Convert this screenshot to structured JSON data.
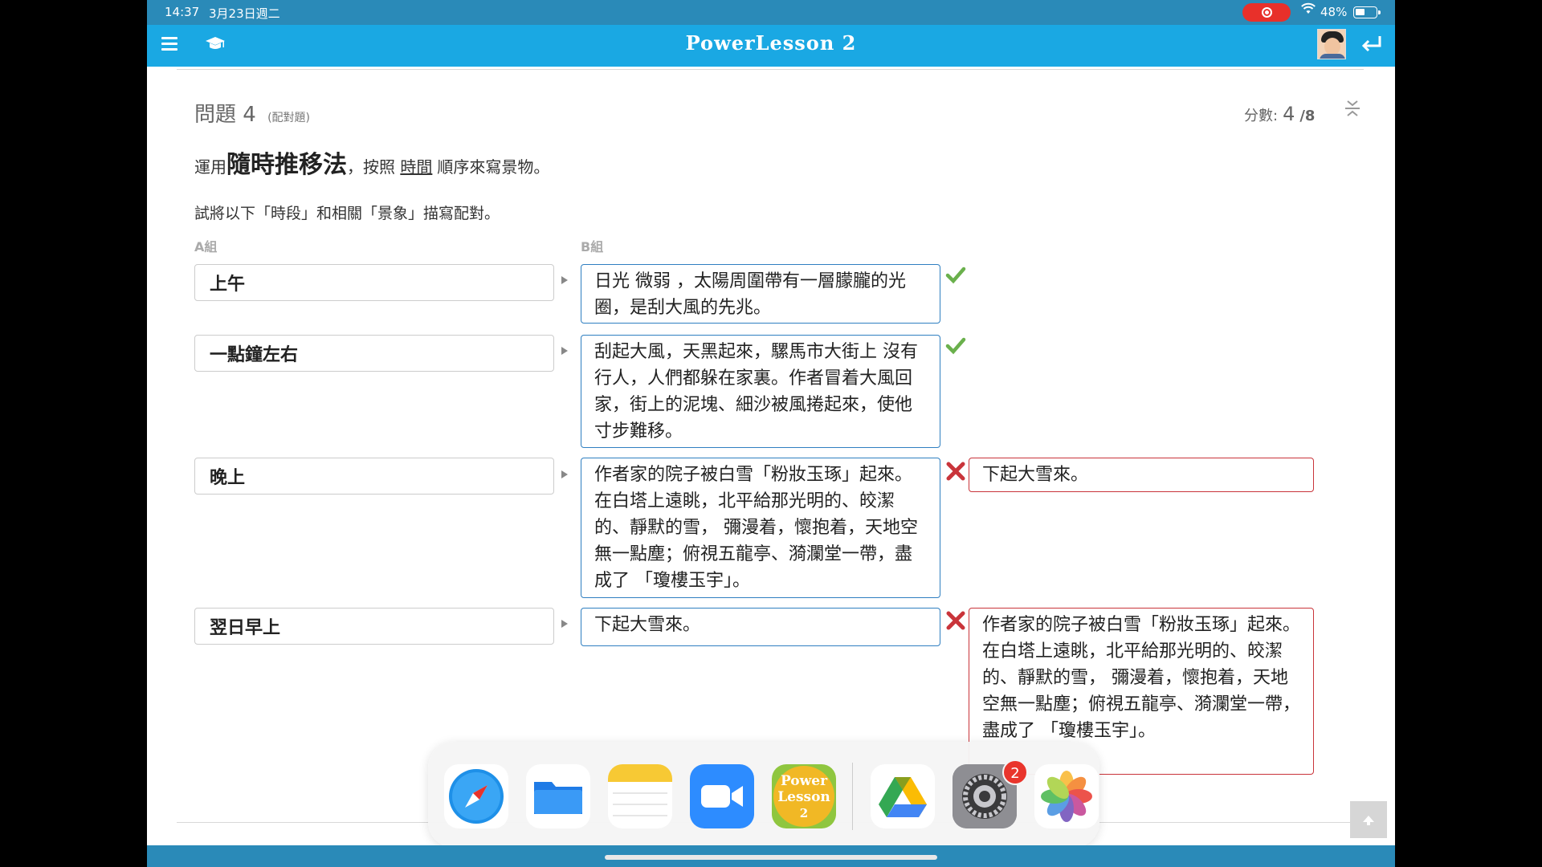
{
  "status_bar": {
    "time": "14:37",
    "date": "3月23日週二",
    "battery": "48%"
  },
  "app": {
    "title": "PowerLesson 2",
    "accent_color": "#1aa8e3"
  },
  "question": {
    "label": "問題",
    "number": "4",
    "type": "(配對題)",
    "score_label": "分數:",
    "score_value": "4",
    "score_max": "/8",
    "instruction_prefix": "運用",
    "instruction_bold": "隨時推移法",
    "instruction_mid": "，按照",
    "instruction_underline": "時間",
    "instruction_suffix": "順序來寫景物。",
    "subinstruction": "試將以下「時段」和相關「景象」描寫配對。",
    "group_a_label": "A組",
    "group_b_label": "B組"
  },
  "pairs": [
    {
      "a": "上午",
      "b": "日光 微弱 ，太陽周圍帶有一層朦朧的光圈，是刮大風的先兆。",
      "result": "correct",
      "correct_answer": ""
    },
    {
      "a": "一點鐘左右",
      "b": "刮起大風，天黑起來，騾馬市大街上 沒有行人，人們都躲在家裏。作者冒着大風回家，街上的泥塊、細沙被風捲起來，使他寸步難移。",
      "result": "correct",
      "correct_answer": ""
    },
    {
      "a": "晚上",
      "b": "作者家的院子被白雪「粉妝玉琢」起來。在白塔上遠眺，北平給那光明的、皎潔的、靜默的雪， 彌漫着，懷抱着，天地空無一點塵；俯視五龍亭、漪瀾堂一帶，盡成了 「瓊樓玉宇」。",
      "result": "wrong",
      "correct_answer": "下起大雪來。"
    },
    {
      "a": "翌日早上",
      "b": "下起大雪來。",
      "result": "wrong",
      "correct_answer": "作者家的院子被白雪「粉妝玉琢」起來。在白塔上遠眺，北平給那光明的、皎潔的、靜默的雪， 彌漫着，懷抱着，天地空無一點塵；俯視五龍亭、漪瀾堂一帶，盡成了 「瓊樓玉宇」。"
    }
  ],
  "dock": {
    "apps": [
      "safari-icon",
      "files-icon",
      "notes-icon",
      "zoom-icon",
      "powerlesson-icon",
      "google-drive-icon",
      "settings-icon",
      "photos-icon"
    ],
    "settings_badge": "2",
    "powerlesson_icon_text": [
      "Power",
      "Lesson",
      "2"
    ]
  },
  "colors": {
    "correct": "#6ab04c",
    "wrong": "#c9343a",
    "b_border": "#2f7fc1"
  }
}
